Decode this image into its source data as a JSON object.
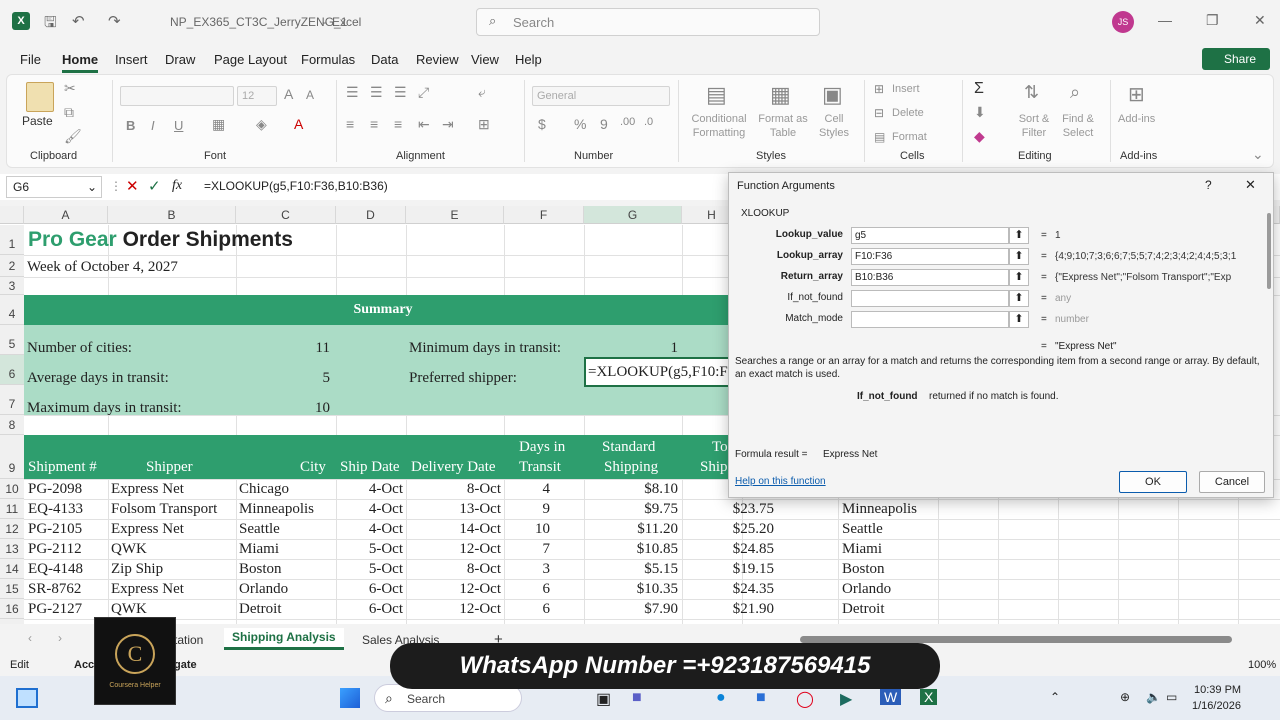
{
  "titlebar": {
    "filename": "NP_EX365_CT3C_JerryZENG_1",
    "app": "Excel",
    "separator": "-",
    "search_placeholder": "Search",
    "avatar": "JS"
  },
  "menu": {
    "items": [
      "File",
      "Home",
      "Insert",
      "Draw",
      "Page Layout",
      "Formulas",
      "Data",
      "Review",
      "View",
      "Help"
    ],
    "share": "Share"
  },
  "ribbon": {
    "groups": [
      "Clipboard",
      "Font",
      "Alignment",
      "Number",
      "Styles",
      "Cells",
      "Editing",
      "Add-ins"
    ],
    "paste": "Paste",
    "font_size": "12",
    "number_format": "General",
    "styles": [
      "Conditional Formatting",
      "Format as Table",
      "Cell Styles"
    ],
    "cells": [
      "Insert",
      "Delete",
      "Format"
    ],
    "editing": [
      "Sort & Filter",
      "Find & Select"
    ],
    "addins": "Add-ins"
  },
  "formula_bar": {
    "namebox": "G6",
    "fx": "fx",
    "formula": "=XLOOKUP(g5,F10:F36,B10:B36)"
  },
  "columns": [
    "A",
    "B",
    "C",
    "D",
    "E",
    "F",
    "G",
    "H"
  ],
  "rows": [
    "1",
    "2",
    "3",
    "4",
    "5",
    "6",
    "7",
    "8",
    "9",
    "10",
    "11",
    "12",
    "13",
    "14",
    "15",
    "16"
  ],
  "sheet": {
    "title_green": "Pro Gear",
    "title_black": "Order Shipments",
    "subtitle": "Week of October 4, 2027",
    "summary": "Summary",
    "num_cities_label": "Number of cities:",
    "num_cities": "11",
    "avg_days_label": "Average days in transit:",
    "avg_days": "5",
    "max_days_label": "Maximum days in transit:",
    "max_days": "10",
    "min_days_label": "Minimum days in transit:",
    "min_days": "1",
    "pref_label": "Preferred shipper:",
    "pref_formula": "=XLOOKUP(g5,F10:F3",
    "headers": [
      "Shipment #",
      "Shipper",
      "City",
      "Ship Date",
      "Delivery Date",
      "Days in",
      "Transit",
      "Standard",
      "Shipping",
      "To",
      "Ship"
    ],
    "data": [
      [
        "PG-2098",
        "Express Net",
        "Chicago",
        "4-Oct",
        "8-Oct",
        "4",
        "$8.10",
        "",
        ""
      ],
      [
        "EQ-4133",
        "Folsom Transport",
        "Minneapolis",
        "4-Oct",
        "13-Oct",
        "9",
        "$9.75",
        "$23.75",
        "Minneapolis"
      ],
      [
        "PG-2105",
        "Express Net",
        "Seattle",
        "4-Oct",
        "14-Oct",
        "10",
        "$11.20",
        "$25.20",
        "Seattle"
      ],
      [
        "PG-2112",
        "QWK",
        "Miami",
        "5-Oct",
        "12-Oct",
        "7",
        "$10.85",
        "$24.85",
        "Miami"
      ],
      [
        "EQ-4148",
        "Zip Ship",
        "Boston",
        "5-Oct",
        "8-Oct",
        "3",
        "$5.15",
        "$19.15",
        "Boston"
      ],
      [
        "SR-8762",
        "Express Net",
        "Orlando",
        "6-Oct",
        "12-Oct",
        "6",
        "$10.35",
        "$24.35",
        "Orlando"
      ],
      [
        "PG-2127",
        "QWK",
        "Detroit",
        "6-Oct",
        "12-Oct",
        "6",
        "$7.90",
        "$21.90",
        "Detroit"
      ]
    ]
  },
  "tabs": {
    "items": [
      "tation",
      "Shipping Analysis",
      "Sales Analysis"
    ],
    "add": "+"
  },
  "status": {
    "mode": "Edit",
    "acc": "Acc",
    "gate": "gate",
    "zoom": "100%"
  },
  "taskbar": {
    "search": "Search",
    "time": "10:39 PM",
    "date": "1/16/2026"
  },
  "dialog": {
    "title": "Function Arguments",
    "help": "?",
    "close": "✕",
    "function": "XLOOKUP",
    "args": [
      {
        "label": "Lookup_value",
        "value": "g5",
        "result": "1"
      },
      {
        "label": "Lookup_array",
        "value": "F10:F36",
        "result": "{4;9;10;7;3;6;6;7;5;5;7;4;2;3;4;2;4;4;5;3;1"
      },
      {
        "label": "Return_array",
        "value": "B10:B36",
        "result": "{\"Express Net\";\"Folsom Transport\";\"Exp"
      },
      {
        "label": "If_not_found",
        "value": "",
        "result": "any"
      },
      {
        "label": "Match_mode",
        "value": "",
        "result": "number"
      }
    ],
    "eq": "=",
    "overall_result": "\"Express Net\"",
    "description": "Searches a range or an array for a match and returns the corresponding item from a second range or array. By default, an exact match is used.",
    "arg_name": "If_not_found",
    "arg_desc": "returned if no match is found.",
    "formula_result_label": "Formula result =",
    "formula_result": "Express Net",
    "help_link": "Help on this function",
    "ok": "OK",
    "cancel": "Cancel"
  },
  "overlay": {
    "text": "WhatsApp Number =+923187569415"
  },
  "logo": {
    "letter": "C",
    "caption": "Coursera Helper"
  }
}
